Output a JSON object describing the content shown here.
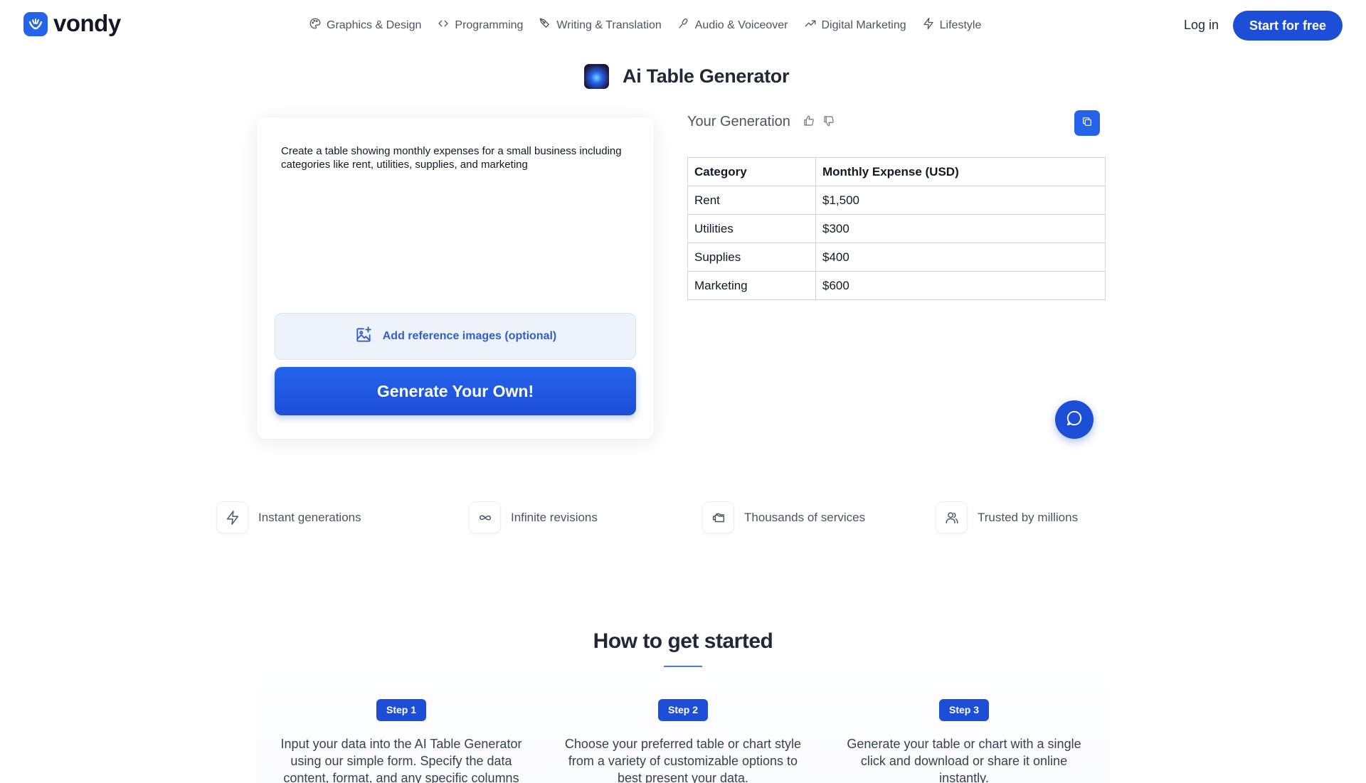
{
  "header": {
    "brand": "vondy",
    "nav": [
      {
        "label": "Graphics & Design",
        "icon": "palette-icon"
      },
      {
        "label": "Programming",
        "icon": "code-icon"
      },
      {
        "label": "Writing & Translation",
        "icon": "pen-nib-icon"
      },
      {
        "label": "Audio & Voiceover",
        "icon": "microphone-icon"
      },
      {
        "label": "Digital Marketing",
        "icon": "trend-up-icon"
      },
      {
        "label": "Lifestyle",
        "icon": "lightning-icon"
      }
    ],
    "login": "Log in",
    "cta": "Start for free"
  },
  "tool": {
    "title": "Ai Table Generator"
  },
  "input": {
    "prompt": "Create a table showing monthly expenses for a small business including categories like rent, utilities, supplies, and marketing",
    "reference_button": "Add reference images (optional)",
    "generate_button": "Generate Your Own!"
  },
  "generation": {
    "label": "Your Generation",
    "table": {
      "headers": [
        "Category",
        "Monthly Expense (USD)"
      ],
      "rows": [
        [
          "Rent",
          "$1,500"
        ],
        [
          "Utilities",
          "$300"
        ],
        [
          "Supplies",
          "$400"
        ],
        [
          "Marketing",
          "$600"
        ]
      ]
    }
  },
  "features": [
    {
      "label": "Instant generations",
      "icon": "lightning-icon"
    },
    {
      "label": "Infinite revisions",
      "icon": "infinity-icon"
    },
    {
      "label": "Thousands of services",
      "icon": "folders-icon"
    },
    {
      "label": "Trusted by millions",
      "icon": "users-icon"
    }
  ],
  "how": {
    "title": "How to get started",
    "steps": [
      {
        "badge": "Step 1",
        "text": "Input your data into the AI Table Generator using our simple form. Specify the data content, format, and any specific columns"
      },
      {
        "badge": "Step 2",
        "text": "Choose your preferred table or chart style from a variety of customizable options to best present your data."
      },
      {
        "badge": "Step 3",
        "text": "Generate your table or chart with a single click and download or share it online instantly."
      }
    ]
  },
  "colors": {
    "accent": "#1d4ed8",
    "accent_light": "#eef2fb",
    "text": "#1f2937"
  }
}
